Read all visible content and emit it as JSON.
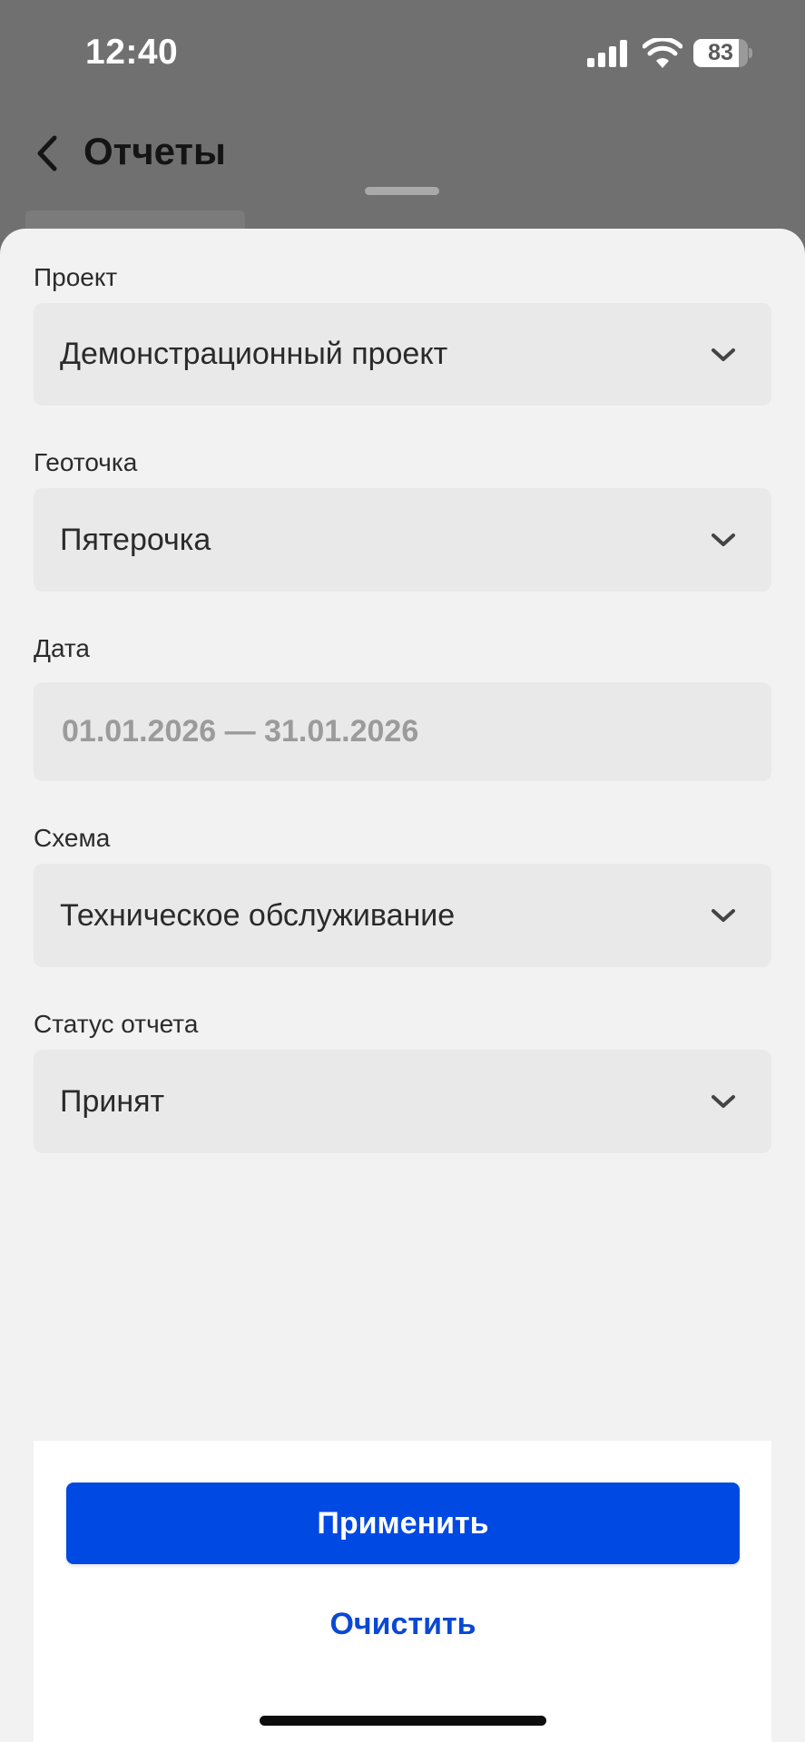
{
  "status_bar": {
    "time": "12:40",
    "battery_level": "83",
    "battery_fraction": 0.83,
    "icons": [
      "signal-icon",
      "wifi-icon",
      "battery-icon"
    ]
  },
  "nav": {
    "title": "Отчеты",
    "back_icon": "chevron-left-icon"
  },
  "filters": {
    "project": {
      "label": "Проект",
      "value": "Демонстрационный проект"
    },
    "geopoint": {
      "label": "Геоточка",
      "value": "Пятерочка"
    },
    "date": {
      "label": "Дата",
      "value": "01.01.2026 — 31.01.2026"
    },
    "scheme": {
      "label": "Схема",
      "value": "Техническое обслуживание"
    },
    "status": {
      "label": "Статус отчета",
      "value": "Принят"
    }
  },
  "actions": {
    "apply_label": "Применить",
    "clear_label": "Очистить"
  },
  "colors": {
    "accent": "#0049e2",
    "link": "#0a48d4",
    "overlay": "#707070",
    "sheet": "#f2f2f2",
    "field": "#e9e9e9"
  }
}
